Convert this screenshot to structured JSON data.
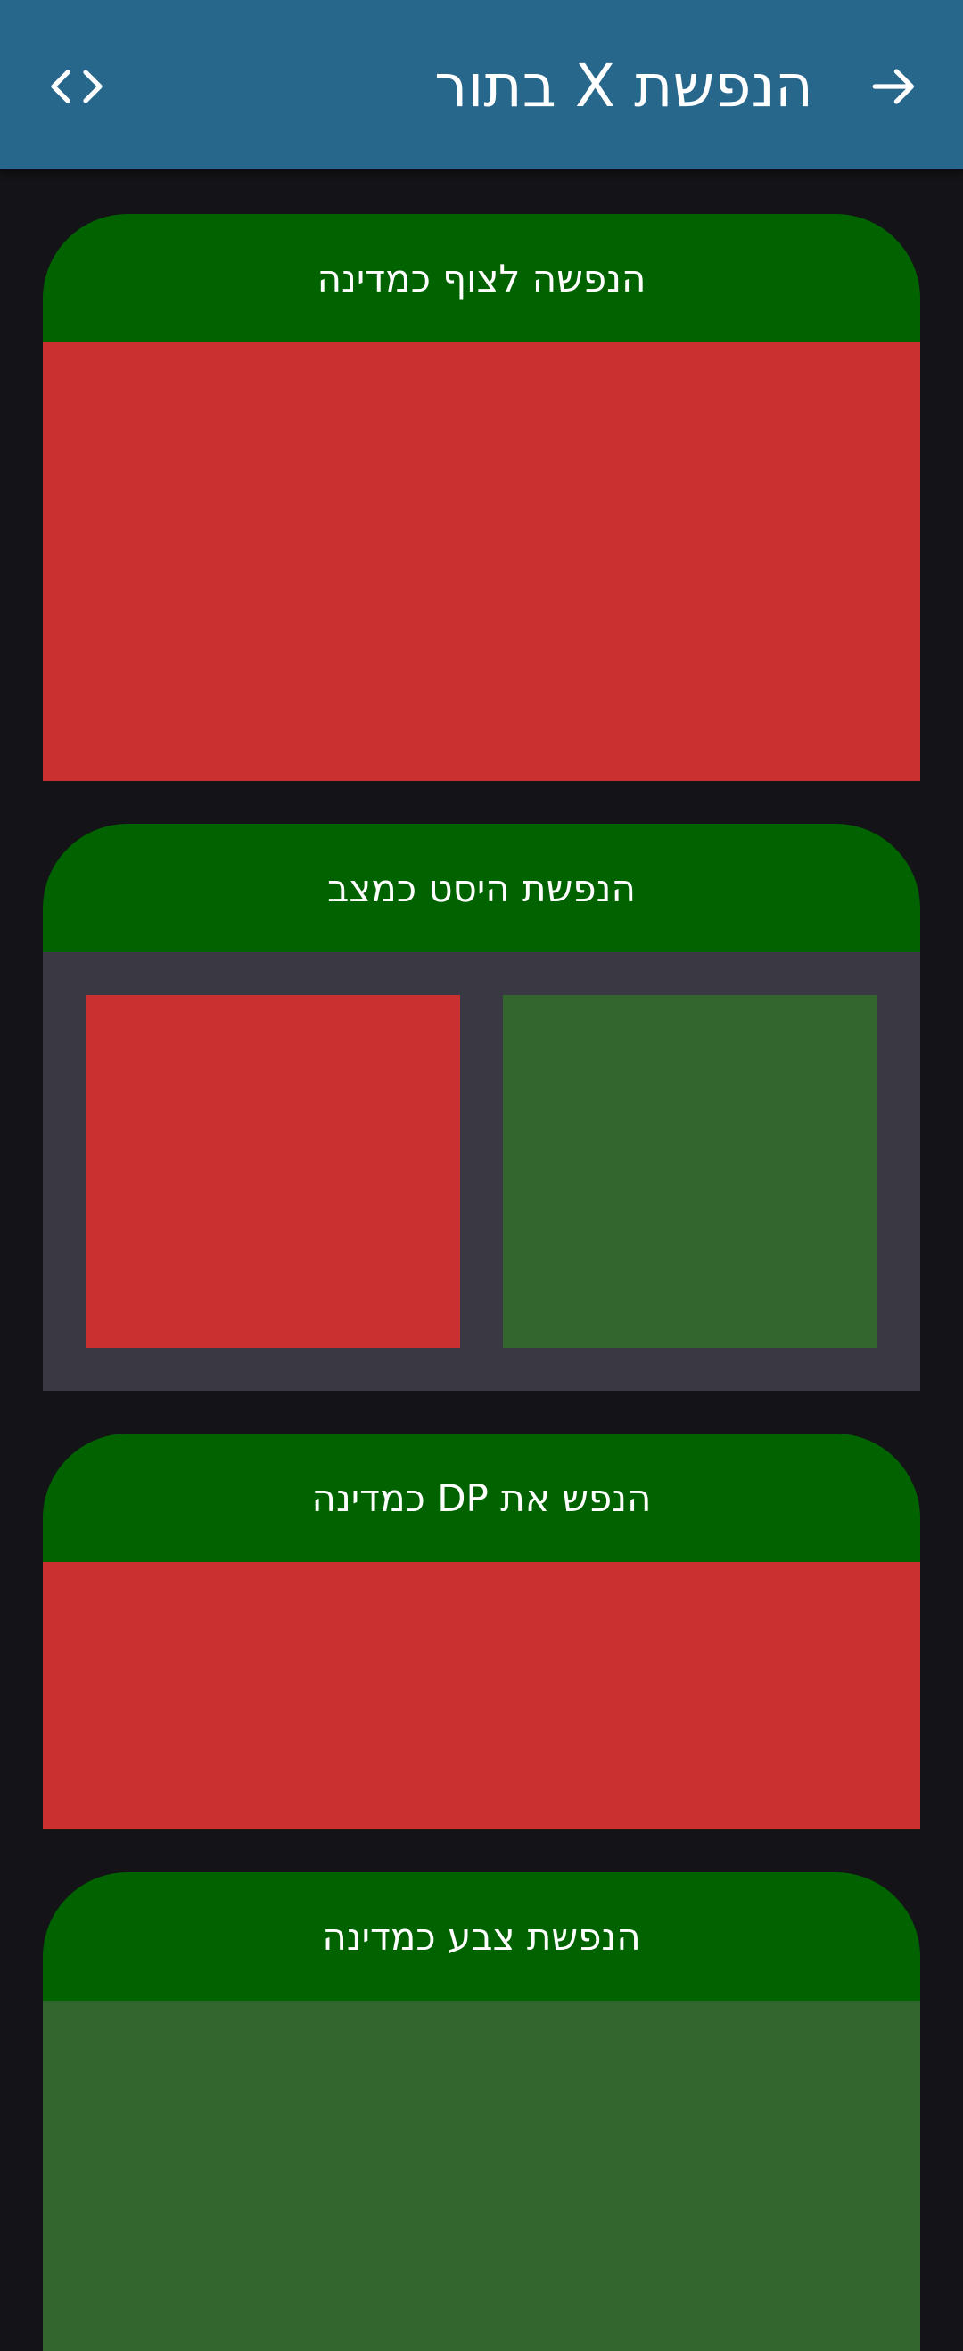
{
  "appbar": {
    "title": "הנפשת X בתור",
    "back_icon": "arrow-right-icon",
    "code_icon": "code-icon"
  },
  "cards": [
    {
      "title": "הנפשה לצוף כמדינה",
      "body": "red"
    },
    {
      "title": "הנפשת היסט כמצב",
      "body": "two-boxes"
    },
    {
      "title": "הנפש את DP כמדינה",
      "body": "red"
    },
    {
      "title": "הנפשת צבע כמדינה",
      "body": "green"
    }
  ],
  "colors": {
    "background": "#141418",
    "appbar": "#27678c",
    "card_header": "#006300",
    "red": "#ca3030",
    "green": "#33652f",
    "panel": "#3a3843"
  }
}
